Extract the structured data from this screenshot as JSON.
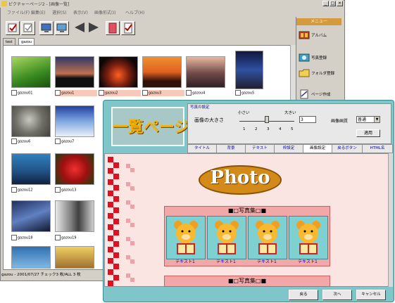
{
  "window": {
    "title": "ピクチャーページ2 - [画像一覧]",
    "controls": [
      "_",
      "□",
      "×"
    ]
  },
  "menubar": [
    "ファイル(F)",
    "編集(E)",
    "選択(S)",
    "表示(V)",
    "画像形式(I)",
    "ヘルプ(H)"
  ],
  "toolbar": [
    "check-icon",
    "uncheck-icon",
    "monitor-icon",
    "monitor-icon",
    "left-arrow-icon",
    "right-arrow-icon",
    "page-icon",
    "page-check-icon"
  ],
  "tabs": [
    "test",
    "gazou"
  ],
  "thumbnails": [
    {
      "label": "gazou01",
      "checked": false,
      "highlight": false
    },
    {
      "label": "gazou1",
      "checked": false,
      "highlight": true
    },
    {
      "label": "gazou2",
      "checked": false,
      "highlight": true
    },
    {
      "label": "gazou3",
      "checked": false,
      "highlight": true
    },
    {
      "label": "gazou4",
      "checked": false,
      "highlight": false
    },
    {
      "label": "gazou5",
      "checked": false,
      "highlight": false
    },
    {
      "label": "gazou6",
      "checked": false,
      "highlight": false
    },
    {
      "label": "gazou7",
      "checked": false,
      "highlight": false
    },
    {
      "label": "gazou12",
      "checked": false,
      "highlight": false
    },
    {
      "label": "gazou13",
      "checked": false,
      "highlight": false
    },
    {
      "label": "gazou18",
      "checked": false,
      "highlight": false
    },
    {
      "label": "gazou19",
      "checked": false,
      "highlight": false
    }
  ],
  "status": "gazou - 2001/07/27  チェック3 枚/ALL 3 枚",
  "sidepanel": {
    "header": "メニュー",
    "items": [
      "アルバム",
      "写真登録",
      "フォルダ登録",
      "ページ作成"
    ]
  },
  "dialog": {
    "logo": "一覧ページ",
    "settings_title": "写真の設定",
    "image_size_label": "画像の大きさ",
    "small_label": "小さい",
    "big_label": "大きい",
    "ticks": [
      "1",
      "2",
      "3",
      "4",
      "5"
    ],
    "slider_value": 3,
    "size_input": "3",
    "quality_label": "画像画質",
    "quality_value": "普通",
    "apply_label": "適用",
    "tabs": [
      "タイトル",
      "背景",
      "テキスト",
      "枠設定",
      "画像設定",
      "戻るボタン",
      "HTML名"
    ],
    "active_tab": "画像設定",
    "preview": {
      "photo_logo": "Photo",
      "album_title": "■□写真集□■",
      "captions": [
        "テキスト1",
        "テキスト1",
        "テキスト1",
        "テキスト1"
      ],
      "album2_title": "■□写真集□■"
    },
    "buttons": {
      "back": "戻る",
      "next": "次へ",
      "cancel": "キャンセル"
    }
  },
  "colors": {
    "dialog_bg": "#7fc6cb",
    "preview_bg": "#fbe5e2",
    "album_bg": "#f2a8a8",
    "accent": "#d49a3c"
  }
}
